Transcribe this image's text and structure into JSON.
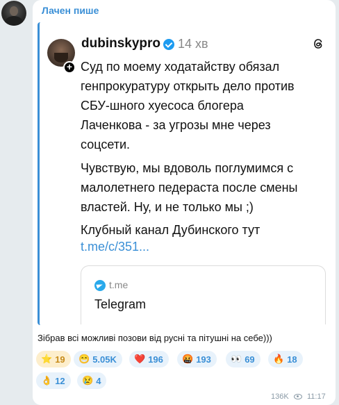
{
  "sender": {
    "name": "Лачен пише"
  },
  "post": {
    "username": "dubinskypro",
    "time_ago": "14 хв",
    "paragraph1": "Суд по моему ходатайству обязал\nгенпрокуратуру открыть дело против\nСБУ-шного хуесоса блогера\nЛаченкова - за угрозы мне через\nсоцсети.",
    "paragraph2": "Чувствую, мы вдоволь поглумимся с\nмалолетнего педераста после смены\nвластей. Ну, и не только мы ;)",
    "paragraph3": "Клубный канал Дубинского тут",
    "link": "t.me/c/351..."
  },
  "preview": {
    "domain": "t.me",
    "title": "Telegram"
  },
  "caption": "Зібрав всі можливі позови від русні та пітушні на себе)))",
  "reactions": [
    {
      "emoji": "⭐",
      "count": "19"
    },
    {
      "emoji": "😁",
      "count": "5.05K"
    },
    {
      "emoji": "❤️",
      "count": "196"
    },
    {
      "emoji": "🤬",
      "count": "193"
    },
    {
      "emoji": "👀",
      "count": "69"
    },
    {
      "emoji": "🔥",
      "count": "18"
    },
    {
      "emoji": "👌",
      "count": "12"
    },
    {
      "emoji": "😢",
      "count": "4"
    }
  ],
  "footer": {
    "views": "136K",
    "time": "11:17"
  },
  "icons": {
    "verified": "verified-icon",
    "threads": "threads-icon",
    "telegram": "telegram-icon",
    "eye": "eye-icon"
  },
  "colors": {
    "accent": "#3a8fd6",
    "background": "#e6ebee",
    "active_reaction": "#fdeecc"
  }
}
